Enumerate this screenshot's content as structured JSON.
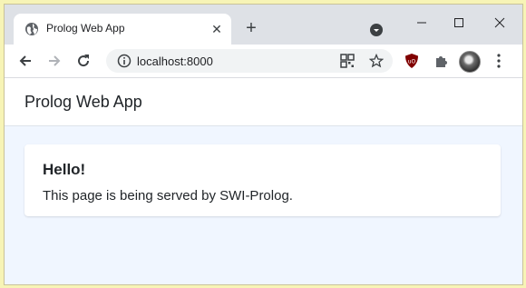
{
  "browser": {
    "tab": {
      "title": "Prolog Web App",
      "favicon": "globe-icon"
    },
    "url": "localhost:8000"
  },
  "navbar": {
    "brand": "Prolog Web App"
  },
  "card": {
    "title": "Hello!",
    "text": "This page is being served by SWI-Prolog."
  },
  "colors": {
    "tabstrip": "#dee1e6",
    "page_bg": "#f0f6ff",
    "ublock": "#800000"
  }
}
